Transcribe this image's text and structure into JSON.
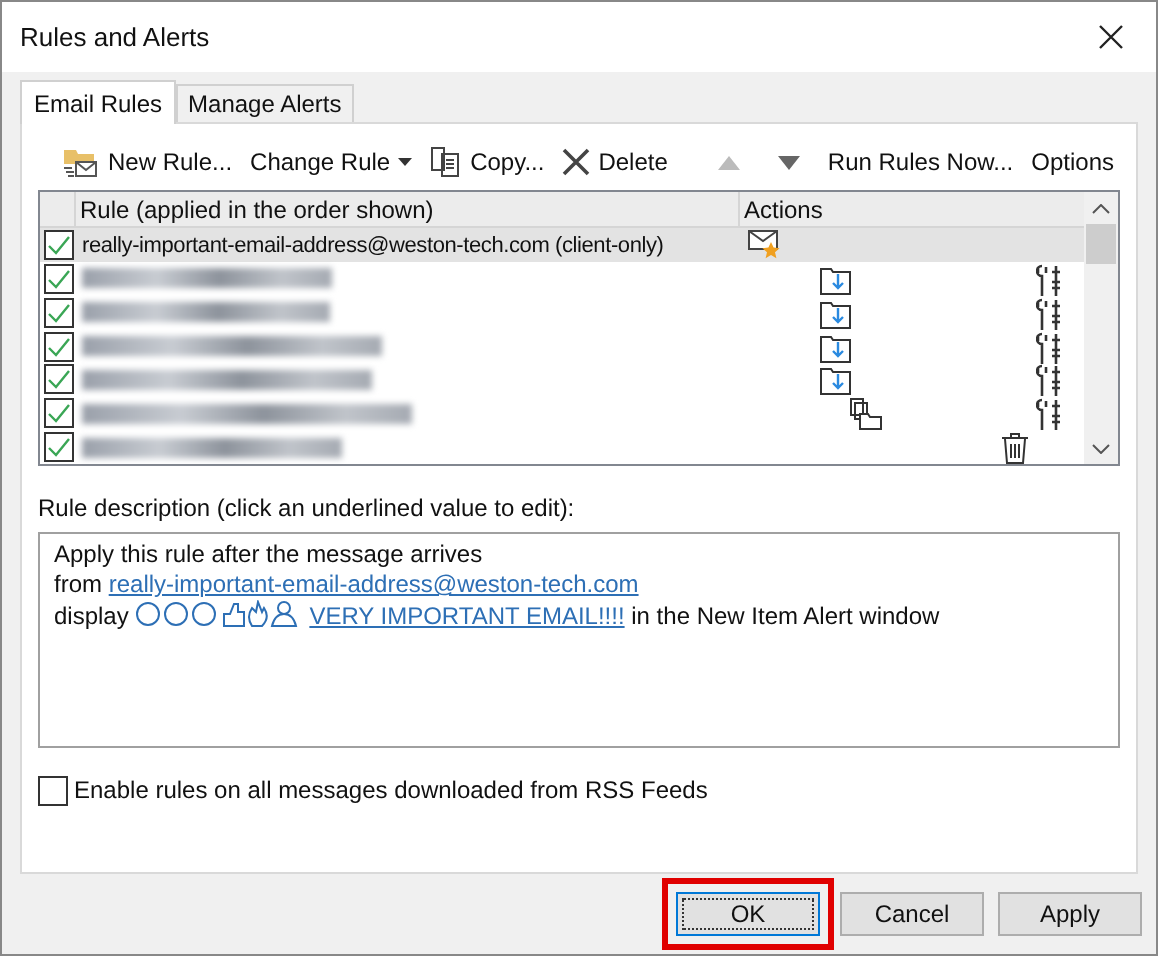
{
  "window": {
    "title": "Rules and Alerts"
  },
  "tabs": [
    {
      "label": "Email Rules",
      "selected": true
    },
    {
      "label": "Manage Alerts",
      "selected": false
    }
  ],
  "toolbar": [
    {
      "kind": "new",
      "label": "New Rule..."
    },
    {
      "kind": "dropdown",
      "label": "Change Rule"
    },
    {
      "kind": "copy",
      "label": "Copy..."
    },
    {
      "kind": "delete",
      "label": "Delete"
    },
    {
      "kind": "separator"
    },
    {
      "kind": "up",
      "disabled": true
    },
    {
      "kind": "down",
      "disabled": false
    },
    {
      "kind": "text",
      "label": "Run Rules Now..."
    },
    {
      "kind": "text",
      "label": "Options"
    }
  ],
  "rules_table": {
    "columns": [
      "Rule (applied in the order shown)",
      "Actions"
    ],
    "rows": [
      {
        "kind": "text",
        "name": "really-important-email-address@weston-tech.com  (client-only)",
        "checked": true,
        "selected": true,
        "actions": [
          {
            "kind": "alert"
          }
        ]
      },
      {
        "kind": "redacted",
        "checked": true,
        "selected": false,
        "actions": [
          {
            "kind": "move"
          },
          {
            "kind": "script"
          }
        ]
      },
      {
        "kind": "redacted",
        "checked": true,
        "selected": false,
        "actions": [
          {
            "kind": "move"
          },
          {
            "kind": "script"
          }
        ]
      },
      {
        "kind": "redacted",
        "checked": true,
        "selected": false,
        "actions": [
          {
            "kind": "move"
          },
          {
            "kind": "script"
          }
        ]
      },
      {
        "kind": "redacted",
        "checked": true,
        "selected": false,
        "actions": [
          {
            "kind": "move"
          },
          {
            "kind": "script"
          }
        ]
      },
      {
        "kind": "redacted",
        "checked": true,
        "selected": false,
        "actions": [
          {
            "kind": "copy"
          },
          {
            "kind": "script"
          }
        ]
      },
      {
        "kind": "redacted",
        "checked": true,
        "selected": false,
        "actions": [
          {
            "kind": "delete"
          }
        ]
      }
    ]
  },
  "rule_description": {
    "label": "Rule description (click an underlined value to edit):",
    "lines": [
      [
        {
          "kind": "text",
          "text": "Apply this rule after the message arrives"
        }
      ],
      [
        {
          "kind": "text",
          "text": "from "
        },
        {
          "kind": "link",
          "text": "really-important-email-address@weston-tech.com"
        }
      ],
      [
        {
          "kind": "text",
          "text": "display "
        },
        {
          "kind": "emoji_link",
          "text": "VERY IMPORTANT EMAIL!!!!"
        },
        {
          "kind": "text",
          "text": " in the New Item Alert window"
        }
      ]
    ]
  },
  "rss_option": {
    "label": "Enable rules on all messages downloaded from RSS Feeds",
    "checked": false
  },
  "buttons": [
    {
      "label": "OK",
      "default": true,
      "highlighted": true
    },
    {
      "label": "Cancel",
      "default": false,
      "highlighted": false
    },
    {
      "label": "Apply",
      "default": false,
      "highlighted": false
    }
  ]
}
